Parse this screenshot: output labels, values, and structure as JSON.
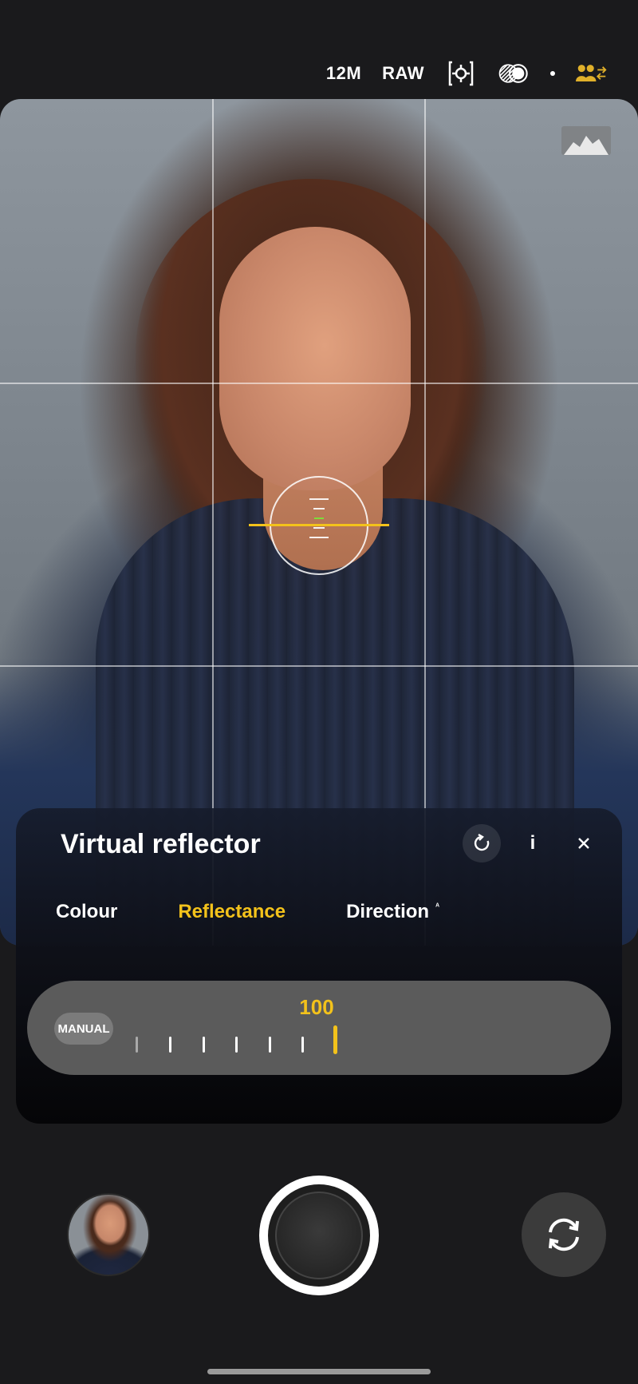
{
  "topbar": {
    "resolution_label": "12M",
    "format_label": "RAW",
    "focus_mode_icon": "focus-target-icon",
    "filter_icon": "filter-circles-icon",
    "portrait_mode_icon": "people-swap-icon"
  },
  "viewfinder": {
    "histogram_icon": "histogram-icon",
    "grid": "3x3",
    "level_color": "#f3c21b"
  },
  "reflector_panel": {
    "title": "Virtual reflector",
    "reset_icon": "reset-icon",
    "info_label": "i",
    "close_icon": "close-icon",
    "tabs": [
      {
        "label": "Colour",
        "active": false
      },
      {
        "label": "Reflectance",
        "active": true
      },
      {
        "label": "Direction",
        "active": false,
        "caret": "ᴬ"
      }
    ],
    "slider": {
      "mode_label": "MANUAL",
      "value": "100"
    }
  },
  "bottom": {
    "gallery_icon": "gallery-thumbnail",
    "shutter_icon": "shutter-button",
    "flip_icon": "flip-camera-icon"
  },
  "colors": {
    "accent": "#f3c21b",
    "background": "#1a1a1c"
  }
}
